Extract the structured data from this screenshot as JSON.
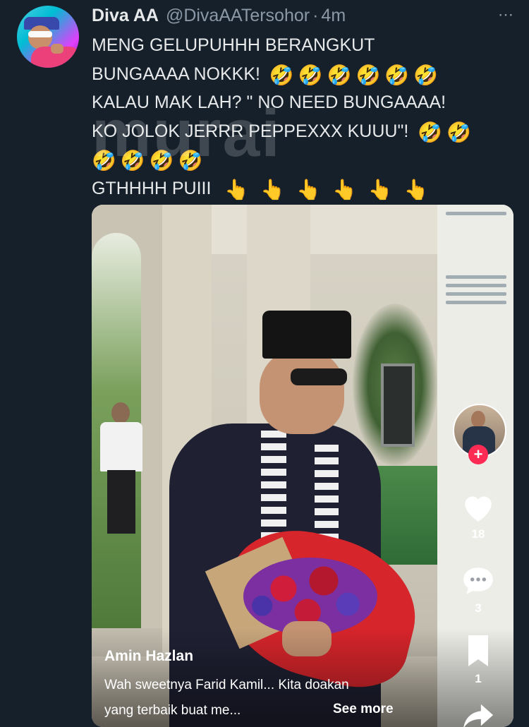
{
  "tweet": {
    "author_name": "Diva AA",
    "handle": "@DivaAATersohor",
    "separator": "·",
    "time": "4m",
    "more_icon": "⋯",
    "lines": [
      "MENG GELUPUHHH BERANGKUT",
      "BUNGAAAA NOKKK!",
      "KALAU MAK LAH? \" NO NEED BUNGAAAA!",
      "KO JOLOK JERRR PEPPEXXX KUUU\"!",
      "",
      "GTHHHH PUIII"
    ],
    "emoji": {
      "rofl": "🤣",
      "pointing": "👆"
    }
  },
  "watermark": "murai",
  "video": {
    "creator_name": "Amin Hazlan",
    "caption_line1": "Wah sweetnya Farid Kamil... Kita doakan",
    "caption_line2": "yang terbaik buat me...",
    "see_more": "See more",
    "follow_icon": "+",
    "likes": "18",
    "comments": "3",
    "bookmarks": "1"
  },
  "colors": {
    "background": "#15202b",
    "text": "#e7e9ea",
    "muted": "#8b98a5",
    "follow_red": "#fe2c55"
  },
  "icons": [
    "more-options-icon",
    "heart-icon",
    "comment-icon",
    "bookmark-icon",
    "share-icon",
    "plus-icon"
  ]
}
